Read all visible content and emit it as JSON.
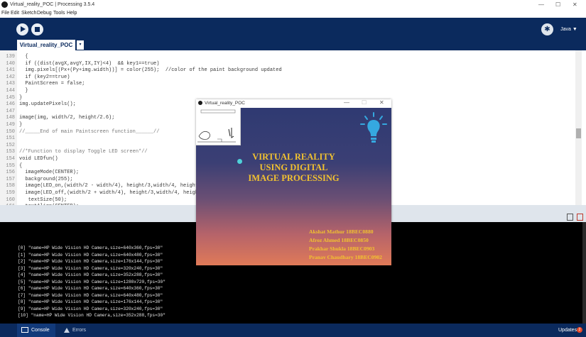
{
  "window": {
    "title": "Virtual_reality_POC | Processing 3.5.4",
    "controls": [
      "—",
      "☐",
      "✕"
    ]
  },
  "menu": [
    "File",
    "Edit",
    "Sketch",
    "Debug",
    "Tools",
    "Help"
  ],
  "toolbar": {
    "run_icon": "play-icon",
    "stop_icon": "stop-icon",
    "debug_icon": "butterfly-icon",
    "mode_label": "Java ▼"
  },
  "tabs": [
    {
      "label": "Virtual_reality_POC"
    }
  ],
  "tab_menu_label": "▾",
  "editor": {
    "lines": [
      {
        "num": "139",
        "text": "  {"
      },
      {
        "num": "140",
        "text": "  if ((dist(avgX,avgY,IX,IY)<4)  && key1==true)"
      },
      {
        "num": "141",
        "text": "  img.pixels[(Px+(Py+img.width))] = color(255);  //color of the paint background updated"
      },
      {
        "num": "142",
        "text": "  if (key2==true)"
      },
      {
        "num": "143",
        "text": "  PaintScreen = false;"
      },
      {
        "num": "144",
        "text": "  }"
      },
      {
        "num": "145",
        "text": "}"
      },
      {
        "num": "146",
        "text": "img.updatePixels();"
      },
      {
        "num": "147",
        "text": ""
      },
      {
        "num": "148",
        "text": "image(img, width/2, height/2.6);"
      },
      {
        "num": "149",
        "text": "}"
      },
      {
        "num": "150",
        "text": "//_____End of main Paintscreen function______//"
      },
      {
        "num": "151",
        "text": ""
      },
      {
        "num": "152",
        "text": ""
      },
      {
        "num": "153",
        "text": "//*Function to display Toggle LED screen*//"
      },
      {
        "num": "154",
        "text": "void LEDfun()"
      },
      {
        "num": "155",
        "text": "{"
      },
      {
        "num": "156",
        "text": "  imageMode(CENTER);"
      },
      {
        "num": "157",
        "text": "  background(255);"
      },
      {
        "num": "158",
        "text": "  image(LED_on,(width/2 - width/4), height/3,width/4, height/5);"
      },
      {
        "num": "159",
        "text": "  image(LED_off,(width/2 + width/4), height/3,width/4, height/5);"
      },
      {
        "num": "160",
        "text": "   textSize(50);"
      },
      {
        "num": "161",
        "text": "  textAlign(CENTER);"
      }
    ]
  },
  "console_lines": [
    "[0] \"name=HP Wide Vision HD Camera,size=640x360,fps=30\"",
    "[1] \"name=HP Wide Vision HD Camera,size=640x480,fps=30\"",
    "[2] \"name=HP Wide Vision HD Camera,size=176x144,fps=30\"",
    "[3] \"name=HP Wide Vision HD Camera,size=320x240,fps=30\"",
    "[4] \"name=HP Wide Vision HD Camera,size=352x288,fps=30\"",
    "[5] \"name=HP Wide Vision HD Camera,size=1280x720,fps=30\"",
    "[6] \"name=HP Wide Vision HD Camera,size=640x360,fps=30\"",
    "[7] \"name=HP Wide Vision HD Camera,size=640x480,fps=30\"",
    "[8] \"name=HP Wide Vision HD Camera,size=176x144,fps=30\"",
    "[9] \"name=HP Wide Vision HD Camera,size=320x240,fps=30\"",
    "[10] \"name=HP Wide Vision HD Camera,size=352x288,fps=30\""
  ],
  "bottom_tabs": {
    "console": "Console",
    "errors": "Errors"
  },
  "updates": {
    "label": "Updates",
    "count": "2"
  },
  "sketch_window": {
    "title": "Virtual_reality_POC",
    "heading": [
      "VIRTUAL REALITY",
      "USING DIGITAL",
      "IMAGE PROCESSING"
    ],
    "credits": [
      "Akshat Mathur 18BEC0880",
      "Afroz Ahmed 18BEC0850",
      "Prakhar Shukla 18BEC0903",
      "Pranav Chaudhary 18BEC0902"
    ],
    "colors": {
      "text": "#f2c230",
      "bulb": "#35a8e0",
      "cursor_dot": "#4fd1d9"
    }
  }
}
